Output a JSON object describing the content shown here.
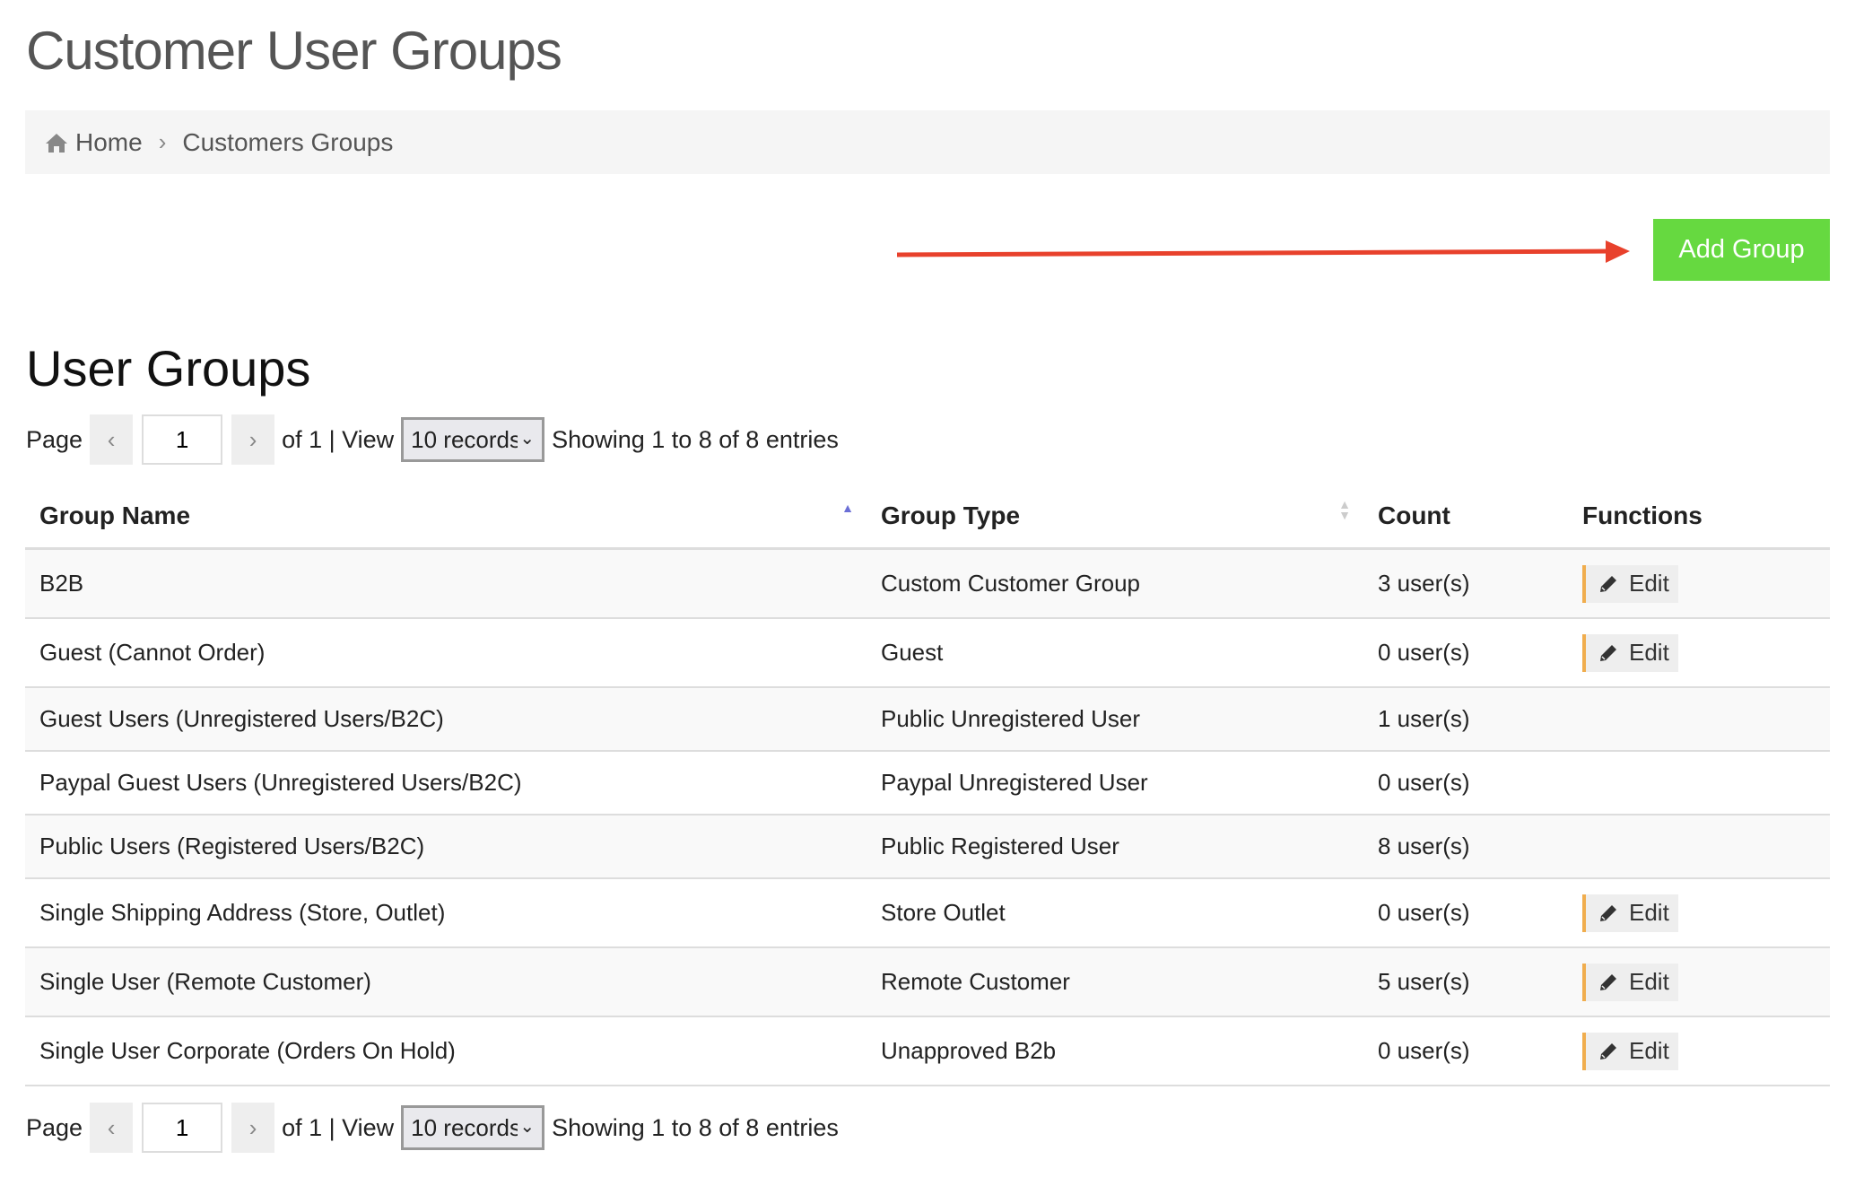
{
  "page": {
    "title": "Customer User Groups"
  },
  "breadcrumb": {
    "items": [
      {
        "label": "Home",
        "icon": "home-icon"
      },
      {
        "label": "Customers Groups"
      }
    ]
  },
  "actions": {
    "add_group_label": "Add Group",
    "add_group_color": "#66d940",
    "annotation_arrow_color": "#e8412c"
  },
  "section": {
    "title": "User Groups"
  },
  "pager": {
    "page_label": "Page",
    "prev": "‹",
    "next": "›",
    "current_page": "1",
    "of_view": "of 1 | View",
    "view_select": "10 records",
    "showing": "Showing 1 to 8 of 8 entries"
  },
  "table": {
    "columns": [
      "Group Name",
      "Group Type",
      "Count",
      "Functions"
    ],
    "sort": {
      "Group Name": "ascending",
      "Group Type": "unsorted"
    },
    "edit_label": "Edit",
    "rows": [
      {
        "name": "B2B",
        "type": "Custom Customer Group",
        "count": "3 user(s)",
        "editable": true
      },
      {
        "name": "Guest (Cannot Order)",
        "type": "Guest",
        "count": "0 user(s)",
        "editable": true
      },
      {
        "name": "Guest Users (Unregistered Users/B2C)",
        "type": "Public Unregistered User",
        "count": "1 user(s)",
        "editable": false
      },
      {
        "name": "Paypal Guest Users (Unregistered Users/B2C)",
        "type": "Paypal Unregistered User",
        "count": "0 user(s)",
        "editable": false
      },
      {
        "name": "Public Users (Registered Users/B2C)",
        "type": "Public Registered User",
        "count": "8 user(s)",
        "editable": false
      },
      {
        "name": "Single Shipping Address (Store, Outlet)",
        "type": "Store Outlet",
        "count": "0 user(s)",
        "editable": true
      },
      {
        "name": "Single User (Remote Customer)",
        "type": "Remote Customer",
        "count": "5 user(s)",
        "editable": true
      },
      {
        "name": "Single User Corporate (Orders On Hold)",
        "type": "Unapproved B2b",
        "count": "0 user(s)",
        "editable": true
      }
    ]
  }
}
